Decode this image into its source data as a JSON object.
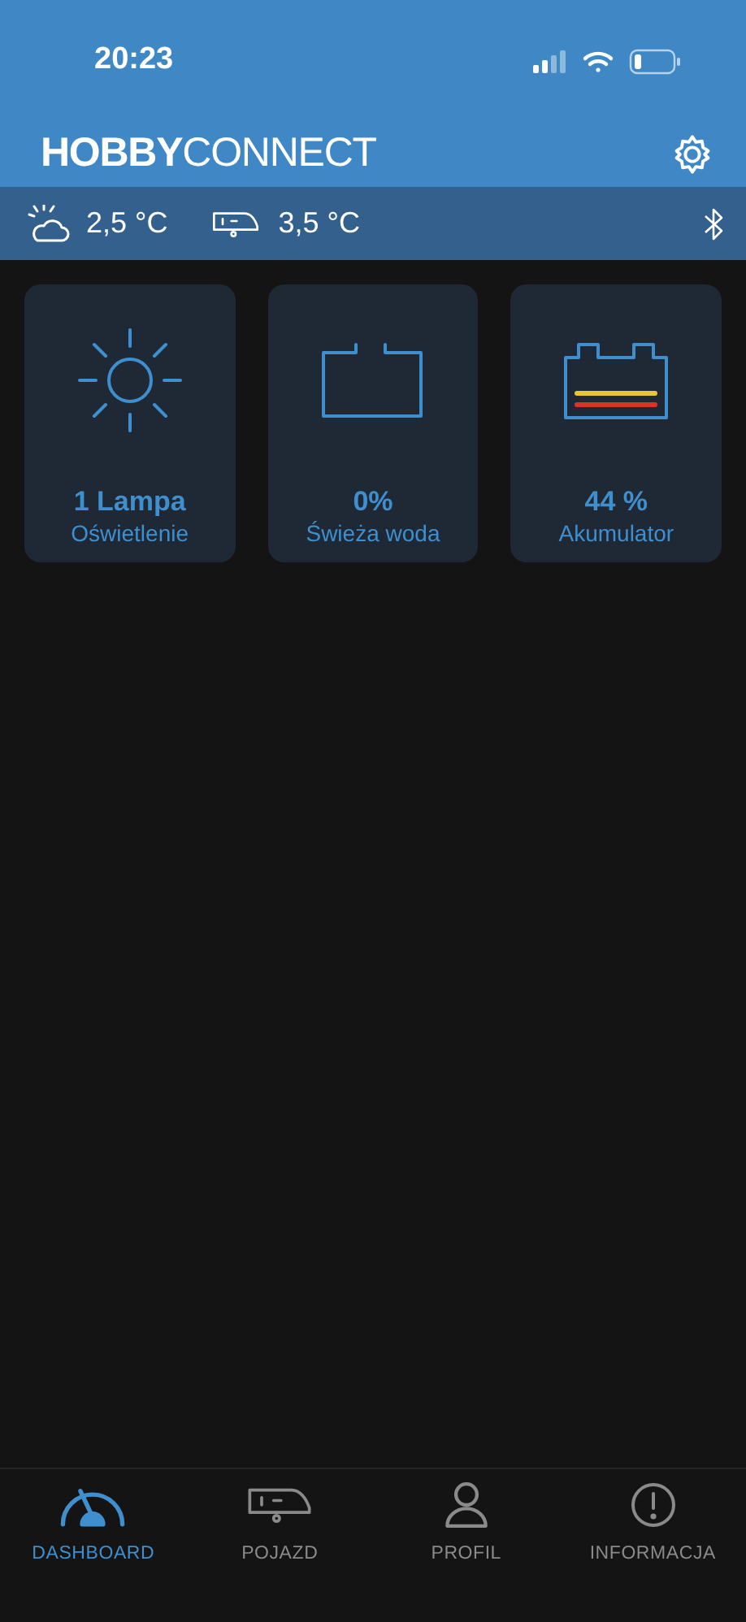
{
  "status_bar": {
    "time": "20:23"
  },
  "header": {
    "logo": "**HOBBY**CONNECT"
  },
  "conditions": [
    {
      "kind": "outside",
      "reading": "2,5 °C"
    },
    {
      "kind": "vehicle",
      "reading": "3,5 °C"
    }
  ],
  "tiles": [
    {
      "kind": "lamp",
      "value": "1 Lampa",
      "label": "Oświetlenie"
    },
    {
      "kind": "water",
      "value": "0%",
      "label": "Świeża woda"
    },
    {
      "kind": "battery",
      "value": "44 %",
      "label": "Akumulator"
    }
  ],
  "tabs": [
    {
      "kind": "dashboard",
      "label": "DASHBOARD",
      "selected": true
    },
    {
      "kind": "vehicle",
      "label": "POJAZD",
      "selected": false
    },
    {
      "kind": "profile",
      "label": "PROFIL",
      "selected": false
    },
    {
      "kind": "info",
      "label": "INFORMACJA",
      "selected": false
    }
  ]
}
